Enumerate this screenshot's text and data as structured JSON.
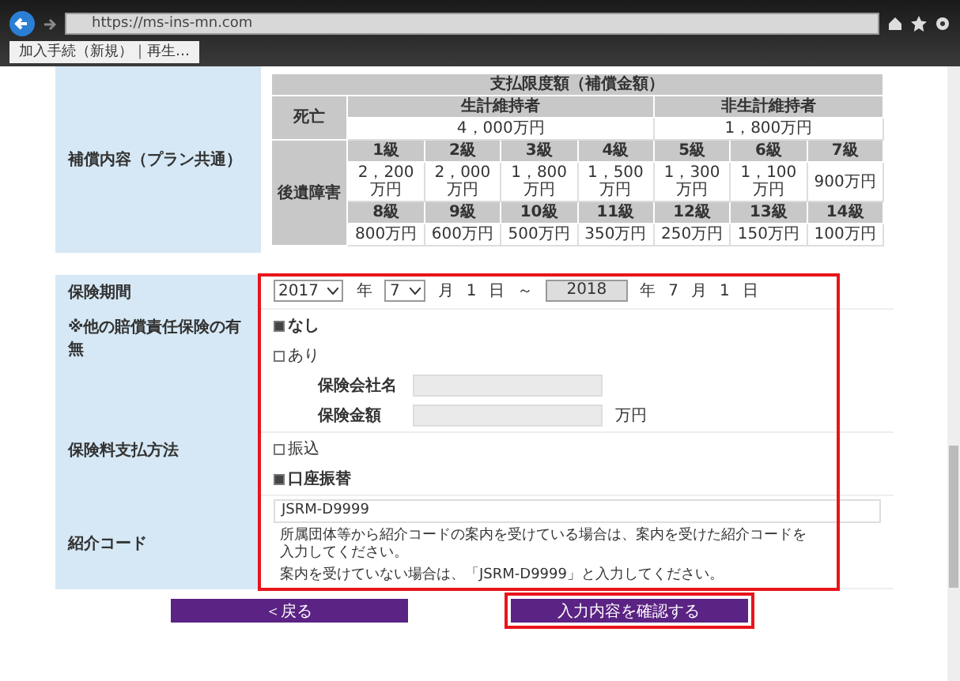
{
  "browser": {
    "url": "https://ms-ins-mn.com",
    "tab_title": "加入手続（新規）｜再生…"
  },
  "coverage": {
    "label": "補償内容（プラン共通）",
    "header": "支払限度額（補償金額）",
    "death": {
      "label": "死亡",
      "columns": [
        {
          "heading": "生計維持者",
          "amount": "4，000万円"
        },
        {
          "heading": "非生計維持者",
          "amount": "1，800万円"
        }
      ]
    },
    "disability": {
      "label": "後遺障害",
      "rows": [
        [
          {
            "grade": "1級",
            "amount": "2，200万円"
          },
          {
            "grade": "2級",
            "amount": "2，000万円"
          },
          {
            "grade": "3級",
            "amount": "1，800万円"
          },
          {
            "grade": "4級",
            "amount": "1，500万円"
          },
          {
            "grade": "5級",
            "amount": "1，300万円"
          },
          {
            "grade": "6級",
            "amount": "1，100万円"
          },
          {
            "grade": "7級",
            "amount": "900万円"
          }
        ],
        [
          {
            "grade": "8級",
            "amount": "800万円"
          },
          {
            "grade": "9級",
            "amount": "600万円"
          },
          {
            "grade": "10級",
            "amount": "500万円"
          },
          {
            "grade": "11級",
            "amount": "350万円"
          },
          {
            "grade": "12級",
            "amount": "250万円"
          },
          {
            "grade": "13級",
            "amount": "150万円"
          },
          {
            "grade": "14級",
            "amount": "100万円"
          }
        ]
      ]
    }
  },
  "form": {
    "highlighted": true,
    "period": {
      "label": "保険期間",
      "parts": [
        {
          "kind": "select",
          "value": "2017"
        },
        {
          "kind": "text",
          "value": "年"
        },
        {
          "kind": "select",
          "value": "7"
        },
        {
          "kind": "text",
          "value": "月"
        },
        {
          "kind": "text",
          "value": "1"
        },
        {
          "kind": "text",
          "value": "日"
        },
        {
          "kind": "text",
          "value": "～"
        },
        {
          "kind": "readonly",
          "value": "2018"
        },
        {
          "kind": "text",
          "value": "年"
        },
        {
          "kind": "text",
          "value": "7"
        },
        {
          "kind": "text",
          "value": "月"
        },
        {
          "kind": "text",
          "value": "1"
        },
        {
          "kind": "text",
          "value": "日"
        }
      ]
    },
    "other_insurance": {
      "label": "※他の賠償責任保険の有無",
      "options": [
        {
          "label": "なし",
          "selected": true
        },
        {
          "label": "あり",
          "selected": false
        }
      ],
      "fields": [
        {
          "label": "保険会社名"
        },
        {
          "label": "保険金額",
          "unit": "万円"
        }
      ]
    },
    "payment": {
      "label": "保険料支払方法",
      "options": [
        {
          "label": "振込",
          "selected": false
        },
        {
          "label": "口座振替",
          "selected": true
        }
      ]
    },
    "referral": {
      "label": "紹介コード",
      "value": "JSRM-D9999",
      "notes": [
        "所属団体等から紹介コードの案内を受けている場合は、案内を受けた紹介コードを入力してください。",
        "案内を受けていない場合は、「JSRM-D9999」と入力してください。"
      ]
    }
  },
  "buttons": [
    {
      "label": "＜戻る",
      "highlighted": false
    },
    {
      "label": "入力内容を確認する",
      "highlighted": true
    }
  ]
}
